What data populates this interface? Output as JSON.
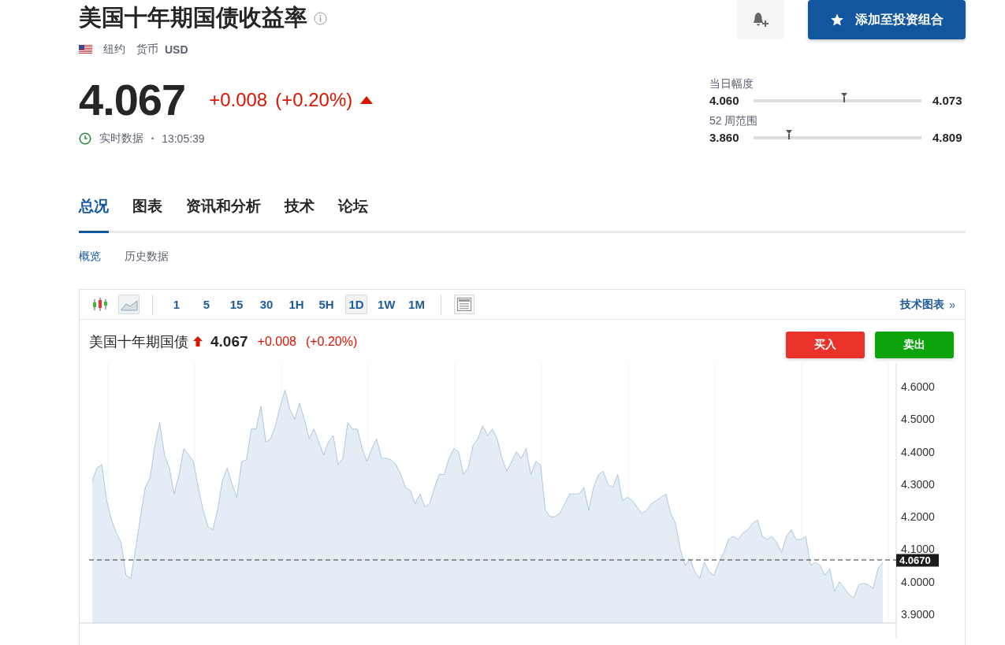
{
  "title": "美国十年期国债收益率",
  "portfolio_button": "添加至投资组合",
  "exchange": "纽约",
  "currency_label": "货币",
  "currency": "USD",
  "price": "4.067",
  "change": "+0.008",
  "change_percent": "(+0.20%)",
  "rising": true,
  "status": "实时数据",
  "separator": "•",
  "time": "13:05:39",
  "ranges": [
    {
      "label": "当日幅度",
      "low": "4.060",
      "high": "4.073",
      "level": 0.54
    },
    {
      "label": "52 周范围",
      "low": "3.860",
      "high": "4.809",
      "level": 0.21
    }
  ],
  "tabs": [
    {
      "label": "总况",
      "selected": true
    },
    {
      "label": "图表",
      "selected": false
    },
    {
      "label": "资讯和分析",
      "selected": false
    },
    {
      "label": "技术",
      "selected": false
    },
    {
      "label": "论坛",
      "selected": false
    }
  ],
  "subtabs": [
    {
      "label": "概览",
      "selected": true
    },
    {
      "label": "历史数据",
      "selected": false
    }
  ],
  "chart_toolbar": {
    "chart_types": [
      {
        "kind": "candlestick",
        "selected": false
      },
      {
        "kind": "area",
        "selected": true
      }
    ],
    "intervals": [
      {
        "label": "1",
        "selected": false
      },
      {
        "label": "5",
        "selected": false
      },
      {
        "label": "15",
        "selected": false
      },
      {
        "label": "30",
        "selected": false
      },
      {
        "label": "1H",
        "selected": false
      },
      {
        "label": "5H",
        "selected": false
      },
      {
        "label": "1D",
        "selected": true
      },
      {
        "label": "1W",
        "selected": false
      },
      {
        "label": "1M",
        "selected": false
      }
    ],
    "link": "技术图表",
    "link_icon": "»"
  },
  "chart_header": {
    "name": "美国十年期国债",
    "price": "4.067",
    "change": "+0.008",
    "change_percent": "(+0.20%)",
    "rising": true
  },
  "trade_buttons": [
    {
      "label": "买入",
      "kind": "buy"
    },
    {
      "label": "卖出",
      "kind": "sell"
    }
  ],
  "chart_data": {
    "type": "area",
    "ylim": [
      3.873,
      4.673
    ],
    "yticks": [
      {
        "value": 4.6,
        "label": "4.6000"
      },
      {
        "value": 4.5,
        "label": "4.5000"
      },
      {
        "value": 4.4,
        "label": "4.4000"
      },
      {
        "value": 4.3,
        "label": "4.3000"
      },
      {
        "value": 4.2,
        "label": "4.2000"
      },
      {
        "value": 4.1,
        "label": "4.1000"
      },
      {
        "value": 4.0,
        "label": "4.0000"
      },
      {
        "value": 3.9,
        "label": "3.9000"
      }
    ],
    "series": [
      {
        "color": "#7fa8cc",
        "values": [
          4.31,
          4.35,
          4.36,
          4.25,
          4.19,
          4.15,
          4.12,
          4.02,
          4.01,
          4.1,
          4.2,
          4.29,
          4.32,
          4.42,
          4.49,
          4.39,
          4.35,
          4.27,
          4.33,
          4.41,
          4.39,
          4.37,
          4.29,
          4.22,
          4.17,
          4.16,
          4.22,
          4.31,
          4.35,
          4.3,
          4.26,
          4.37,
          4.375,
          4.47,
          4.47,
          4.54,
          4.43,
          4.44,
          4.48,
          4.54,
          4.59,
          4.53,
          4.5,
          4.55,
          4.5,
          4.44,
          4.47,
          4.43,
          4.39,
          4.43,
          4.45,
          4.36,
          4.38,
          4.49,
          4.47,
          4.47,
          4.41,
          4.37,
          4.41,
          4.44,
          4.38,
          4.38,
          4.375,
          4.36,
          4.33,
          4.29,
          4.28,
          4.24,
          4.27,
          4.23,
          4.24,
          4.29,
          4.33,
          4.33,
          4.38,
          4.41,
          4.4,
          4.33,
          4.35,
          4.42,
          4.44,
          4.48,
          4.45,
          4.47,
          4.44,
          4.38,
          4.34,
          4.37,
          4.4,
          4.38,
          4.41,
          4.33,
          4.37,
          4.36,
          4.22,
          4.2,
          4.2,
          4.21,
          4.24,
          4.27,
          4.27,
          4.27,
          4.29,
          4.22,
          4.29,
          4.33,
          4.34,
          4.3,
          4.29,
          4.33,
          4.25,
          4.26,
          4.25,
          4.23,
          4.21,
          4.22,
          4.24,
          4.25,
          4.26,
          4.27,
          4.21,
          4.18,
          4.1,
          4.05,
          4.07,
          4.03,
          4.01,
          4.06,
          4.03,
          4.02,
          4.06,
          4.09,
          4.13,
          4.14,
          4.13,
          4.15,
          4.16,
          4.18,
          4.19,
          4.14,
          4.13,
          4.14,
          4.12,
          4.09,
          4.14,
          4.16,
          4.13,
          4.13,
          4.14,
          4.05,
          4.06,
          4.05,
          4.02,
          4.04,
          3.97,
          4.0,
          3.98,
          3.96,
          3.95,
          3.99,
          3.995,
          3.99,
          3.98,
          4.04,
          4.06
        ]
      }
    ],
    "ref_lines": [
      {
        "axis": "y",
        "value": 4.067,
        "label": "4.0670"
      }
    ]
  }
}
